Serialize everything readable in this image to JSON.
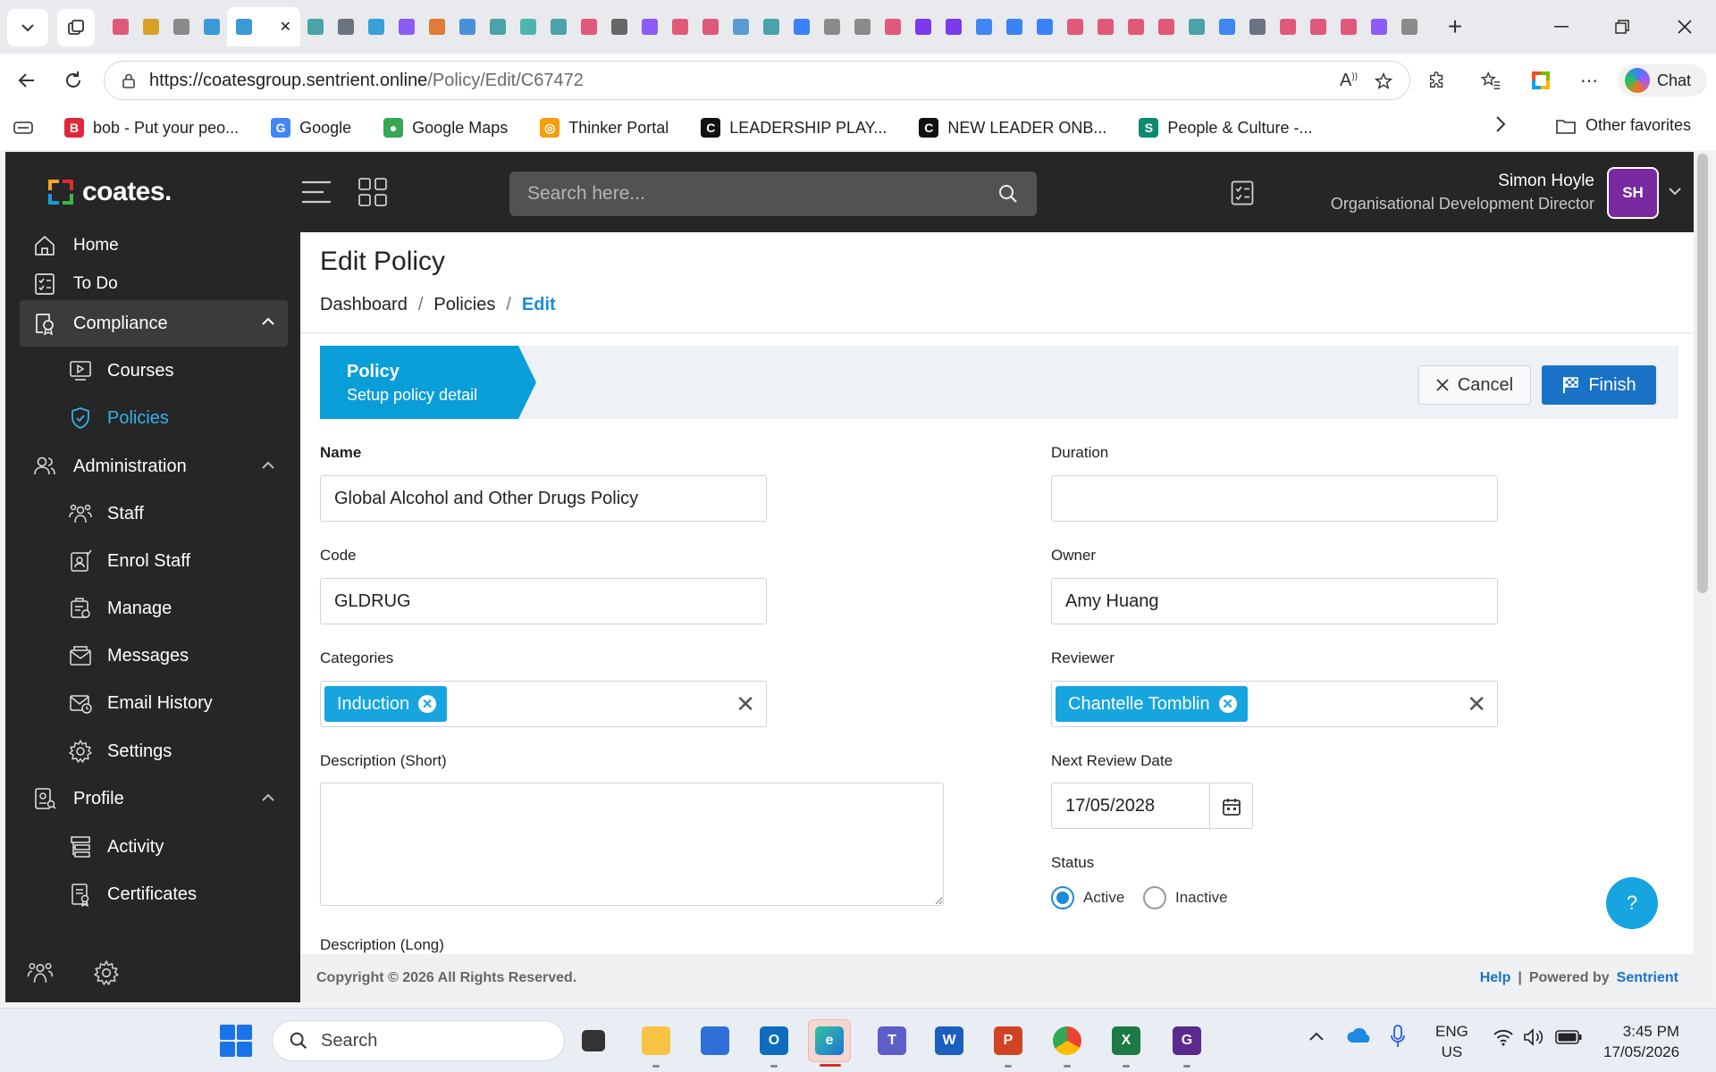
{
  "browser": {
    "url_host": "https://coatesgroup.sentrient.online",
    "url_path": "/Policy/Edit/C67472",
    "copilot_label": "Chat",
    "bookmarks": [
      {
        "label": "bob - Put your peo...",
        "color": "#e0283c",
        "glyph": "B"
      },
      {
        "label": "Google",
        "color": "#4285f4",
        "glyph": "G"
      },
      {
        "label": "Google Maps",
        "color": "#34a853",
        "glyph": "●"
      },
      {
        "label": "Thinker Portal",
        "color": "#f59e0b",
        "glyph": "◎"
      },
      {
        "label": "LEADERSHIP PLAY...",
        "color": "#111111",
        "glyph": "C"
      },
      {
        "label": "NEW LEADER ONB...",
        "color": "#111111",
        "glyph": "C"
      },
      {
        "label": "People & Culture -...",
        "color": "#0f8a6e",
        "glyph": "S"
      }
    ],
    "other_favorites": "Other favorites",
    "tab_colors": [
      "#e0587a",
      "#d9a227",
      "#8a8a8a",
      "#3c9ad6",
      "#ffffff",
      "#4aa3a8",
      "#6b7280",
      "#3aa0d8",
      "#8b5cf6",
      "#e07b39",
      "#4a90d9",
      "#4aa3a8",
      "#4db6ac",
      "#4aa3a8",
      "#e0587a",
      "#666666",
      "#8b5cf6",
      "#e0587a",
      "#e0587a",
      "#5a9bd5",
      "#4aa3a8",
      "#3b82f6",
      "#8a8a8a",
      "#8a8a8a",
      "#e0587a",
      "#7c3aed",
      "#7c3aed",
      "#4285f4",
      "#3b82f6",
      "#3b82f6",
      "#e0587a",
      "#e0587a",
      "#e0587a",
      "#e0587a",
      "#4aa3a8",
      "#4285f4",
      "#6b7280",
      "#e0587a",
      "#e0587a",
      "#e0587a",
      "#8b5cf6",
      "#8a8a8a"
    ]
  },
  "app": {
    "logo_text": "coates.",
    "search_placeholder": "Search here...",
    "user": {
      "name": "Simon Hoyle",
      "role": "Organisational Development Director",
      "initials": "SH"
    },
    "nav": {
      "home": "Home",
      "todo": "To Do",
      "compliance": "Compliance",
      "courses": "Courses",
      "policies": "Policies",
      "administration": "Administration",
      "staff": "Staff",
      "enrol_staff": "Enrol Staff",
      "manage": "Manage",
      "messages": "Messages",
      "email_history": "Email History",
      "settings": "Settings",
      "profile": "Profile",
      "activity": "Activity",
      "certificates": "Certificates"
    }
  },
  "page": {
    "title": "Edit Policy",
    "breadcrumb": [
      "Dashboard",
      "Policies",
      "Edit"
    ],
    "step": {
      "title": "Policy",
      "subtitle": "Setup policy detail"
    },
    "cancel_label": "Cancel",
    "finish_label": "Finish"
  },
  "form": {
    "name_label": "Name",
    "name_value": "Global Alcohol and Other Drugs Policy",
    "code_label": "Code",
    "code_value": "GLDRUG",
    "categories_label": "Categories",
    "categories": [
      "Induction"
    ],
    "desc_short_label": "Description (Short)",
    "desc_short_value": "",
    "desc_long_label": "Description (Long)",
    "duration_label": "Duration",
    "duration_value": "",
    "owner_label": "Owner",
    "owner_value": "Amy Huang",
    "reviewer_label": "Reviewer",
    "reviewers": [
      "Chantelle Tomblin"
    ],
    "next_review_label": "Next Review Date",
    "next_review_value": "17/05/2028",
    "status_label": "Status",
    "status_options": [
      "Active",
      "Inactive"
    ],
    "status_selected": "Active"
  },
  "footer": {
    "copyright": "Copyright © 2026 All Rights Reserved.",
    "help": "Help",
    "powered_by": "Powered by",
    "brand": "Sentrient"
  },
  "help_fab": "?",
  "taskbar": {
    "search": "Search",
    "lang_top": "ENG",
    "lang_bottom": "US",
    "time": "3:45 PM",
    "date": "17/05/2026"
  }
}
